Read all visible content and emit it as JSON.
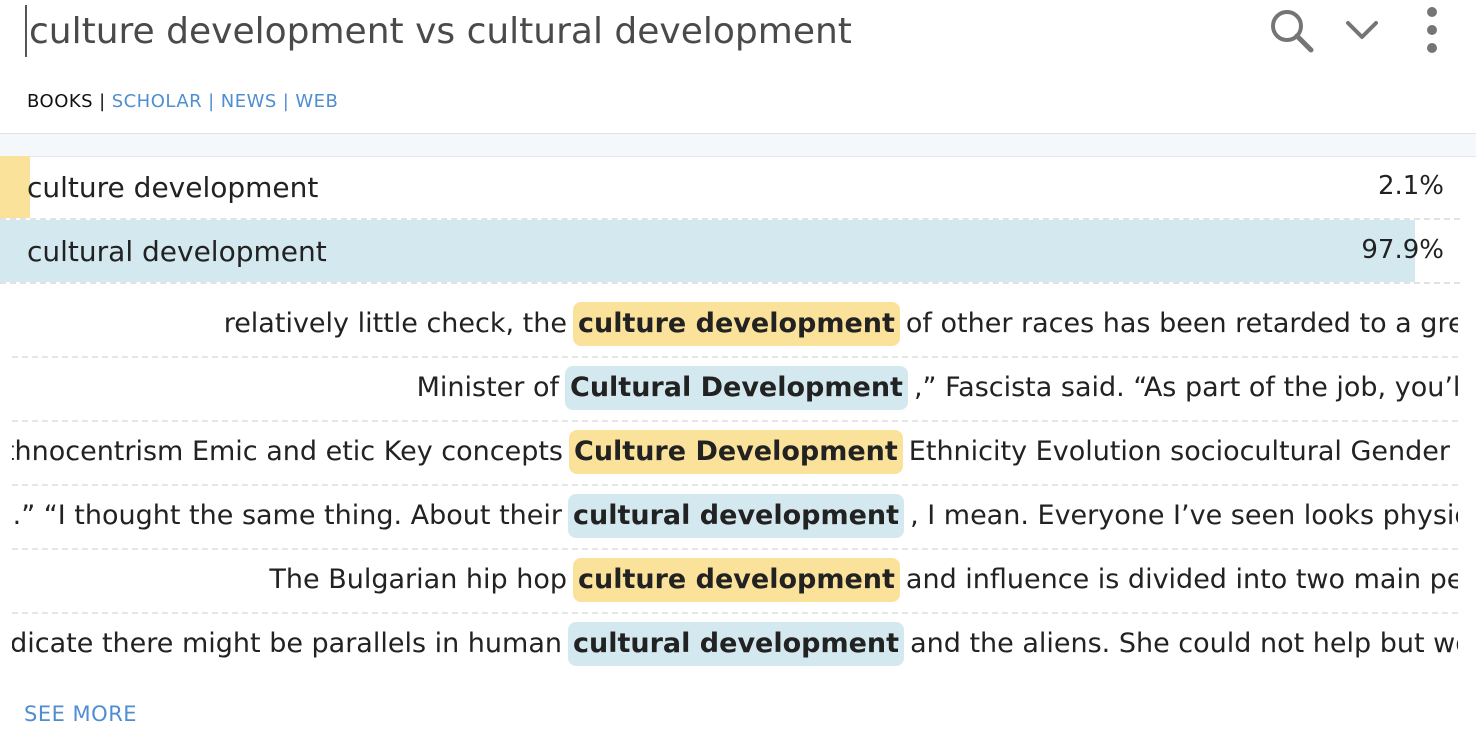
{
  "search": {
    "query": "culture development vs cultural development",
    "icons": [
      "search-icon",
      "chevron-down-icon",
      "more-vertical-icon"
    ]
  },
  "tabs": [
    {
      "label": "BOOKS",
      "active": true
    },
    {
      "label": "SCHOLAR",
      "active": false
    },
    {
      "label": "NEWS",
      "active": false
    },
    {
      "label": "WEB",
      "active": false
    }
  ],
  "tab_separator": "|",
  "colors": {
    "term_a": "#fbe29a",
    "term_b": "#d3e9ef",
    "link": "#4f8ed0"
  },
  "results": [
    {
      "term": "culture development",
      "percent_label": "2.1%",
      "share": 0.021
    },
    {
      "term": "cultural development",
      "percent_label": "97.9%",
      "share": 0.979
    }
  ],
  "snippets": [
    {
      "before": "relatively little check, the",
      "match": "culture development",
      "after": "of other races has been retarded to a grea",
      "term_index": 0
    },
    {
      "before": "Minister of",
      "match": "Cultural Development",
      "after": ",” Fascista said. “As part of the job, you’ll a",
      "term_index": 1
    },
    {
      "before": "Ethnocentrism Emic and etic Key concepts",
      "match": "Culture Development",
      "after": "Ethnicity Evolution sociocultural Gender K",
      "term_index": 0
    },
    {
      "before": "re.” “I thought the same thing. About their",
      "match": "cultural development",
      "after": ", I mean. Everyone I’ve seen looks physical",
      "term_index": 1
    },
    {
      "before": "The Bulgarian hip hop",
      "match": "culture development",
      "after": "and influence is divided into two main per",
      "term_index": 0
    },
    {
      "before": "ndicate there might be parallels in human",
      "match": "cultural development",
      "after": "and the aliens. She could not help but wor",
      "term_index": 1
    }
  ],
  "see_more_label": "SEE MORE"
}
